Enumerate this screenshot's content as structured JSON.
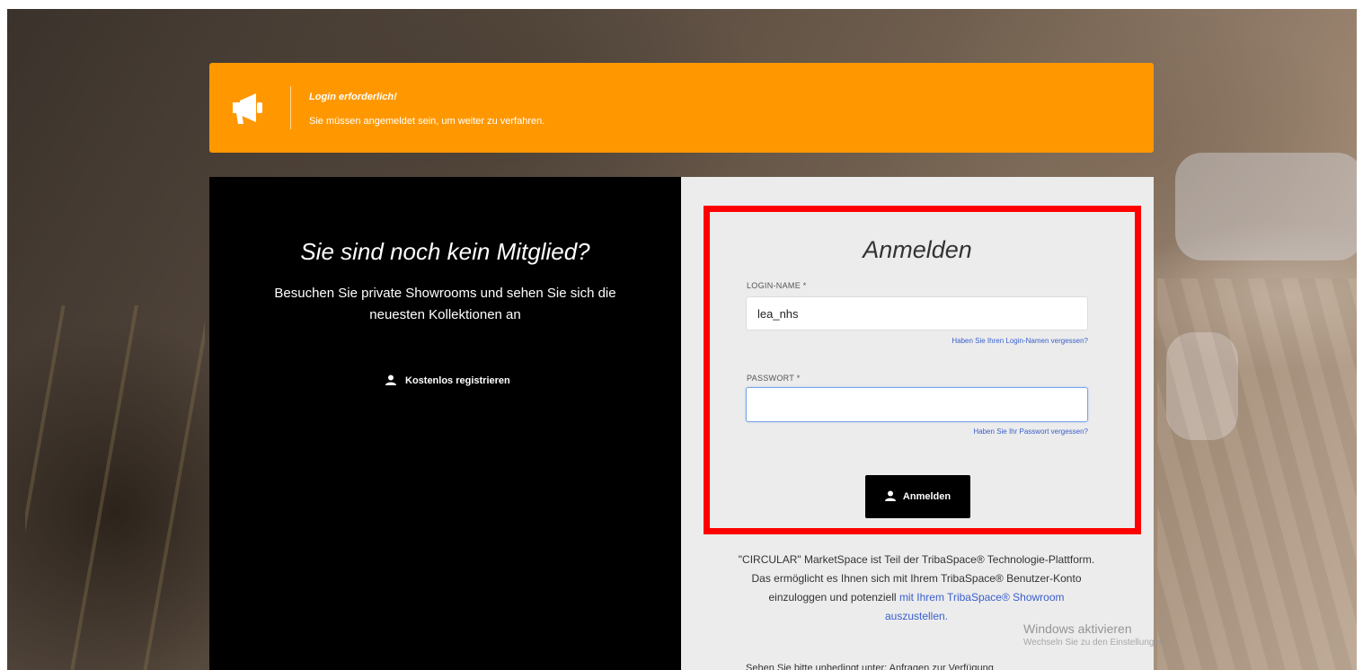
{
  "alert": {
    "icon": "megaphone-icon",
    "title": "Login erforderlich!",
    "message": "Sie müssen angemeldet sein, um weiter zu verfahren."
  },
  "signup": {
    "heading": "Sie sind noch kein Mitglied?",
    "text": "Besuchen Sie private Showrooms und sehen Sie sich die neuesten Kollektionen an",
    "register_icon": "user-icon",
    "register_label": "Kostenlos registrieren"
  },
  "login": {
    "heading": "Anmelden",
    "username_label": "LOGIN-NAME *",
    "username_value": "lea_nhs",
    "forgot_username": "Haben Sie Ihren Login-Namen vergessen?",
    "password_label": "PASSWORT *",
    "password_value": "",
    "forgot_password": "Haben Sie Ihr Passwort vergessen?",
    "submit_icon": "user-icon",
    "submit_label": "Anmelden"
  },
  "footer": {
    "line1": "\"CIRCULAR\" MarketSpace ist Teil der TribaSpace® Technologie-Plattform.",
    "line2": "Das ermöglicht es Ihnen sich mit Ihrem TribaSpace® Benutzer-Konto",
    "line3_pre": "einzuloggen und potenziell ",
    "line3_link": "mit Ihrem TribaSpace® Showroom",
    "line4_link": "auszustellen.",
    "cutoff": "Sehen Sie bitte unbedingt unter: Anfragen zur Verfügung"
  },
  "os_overlay": {
    "title": "Windows aktivieren",
    "subtitle": "Wechseln Sie zu den Einstellungen"
  },
  "colors": {
    "alert_bg": "#ff9800",
    "highlight_border": "#ff0000",
    "link": "#3a5fcd"
  }
}
